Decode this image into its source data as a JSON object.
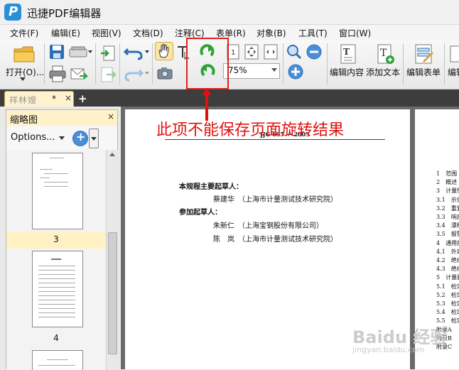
{
  "app": {
    "title": "迅捷PDF编辑器",
    "logo_letter": "P"
  },
  "menu": [
    "文件(F)",
    "编辑(E)",
    "视图(V)",
    "文档(D)",
    "注释(C)",
    "表单(R)",
    "对象(B)",
    "工具(T)",
    "窗口(W)"
  ],
  "toolbar": {
    "open_label": "打开(O)...",
    "zoom_value": "75%",
    "edit_content_label": "编辑内容",
    "add_text_label": "添加文本",
    "edit_form_label": "编辑表单",
    "edit_partial_label": "编辑",
    "icons": [
      "folder-icon",
      "save-icon",
      "scanner-icon",
      "print-icon",
      "email-icon",
      "page-import-icon",
      "page-export-icon",
      "undo-icon",
      "redo-icon",
      "hand-tool-icon",
      "select-text-icon",
      "snapshot-icon",
      "rotate-clockwise-icon",
      "rotate-counterclockwise-icon",
      "actual-size-icon",
      "fit-page-icon",
      "fit-width-icon",
      "zoom-in-icon",
      "zoom-out-icon"
    ]
  },
  "tab": {
    "name": "祥林嫂",
    "modified": "*",
    "close": "×",
    "new": "+"
  },
  "sidebar": {
    "title": "缩略图",
    "close": "×",
    "options_label": "Options...",
    "thumbnails": [
      {
        "page": "3"
      },
      {
        "page": "4"
      }
    ]
  },
  "annotation": {
    "text": "此项不能保存页面旋转结果",
    "color": "#e01010"
  },
  "document": {
    "header": "JJG 695 — 2003",
    "drafters_title": "本规程主要起草人：",
    "drafter1": "蔡建华　（上海市计量测试技术研究院）",
    "participants_title": "参加起草人：",
    "participant1": "朱新仁　（上海宝钢股份有限公司）",
    "participant2": "陈　岚　（上海市计量测试技术研究院）",
    "toc": [
      "1　范围",
      "2　概述",
      "3　计量性",
      "3.1　示值",
      "3.2　重复",
      "3.3　响应",
      "3.4　漂移",
      "3.5　报警",
      "4　通用技",
      "4.1　外观",
      "4.2　绝缘",
      "4.3　绝缘",
      "5　计量器",
      "5.1　检定",
      "5.2　检定",
      "5.3　检定",
      "5.4　检定",
      "5.5　检定",
      "附录A　",
      "附录B　",
      "附录C　"
    ]
  },
  "watermark": {
    "text": "Baidu 经验",
    "url": "jingyan.baidu.com"
  }
}
